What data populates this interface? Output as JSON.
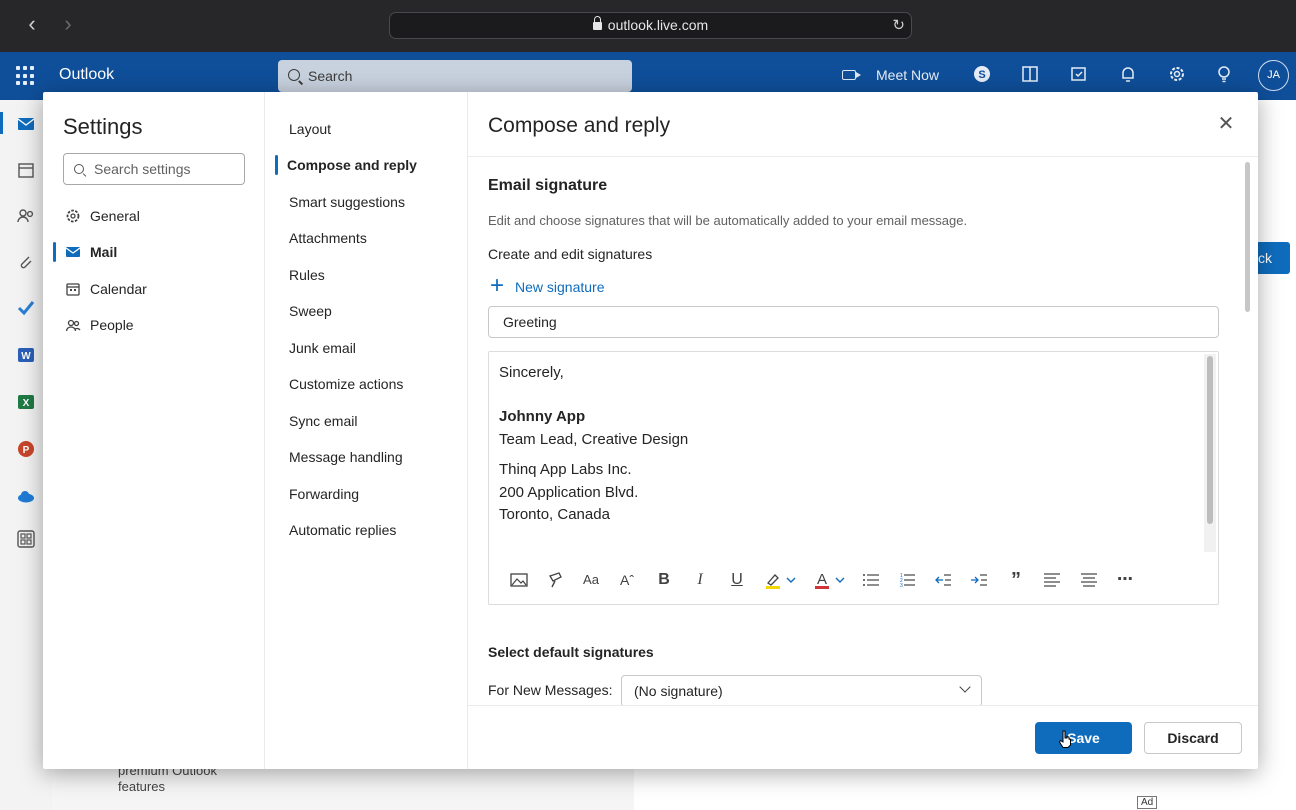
{
  "browser": {
    "url": "outlook.live.com"
  },
  "header": {
    "app_name": "Outlook",
    "search_placeholder": "Search",
    "meet_now": "Meet Now",
    "avatar_initials": "JA"
  },
  "background": {
    "premium_text_line1": "premium Outlook",
    "premium_text_line2": "features",
    "ad_badge": "Ad",
    "partial_button": "ck"
  },
  "settings": {
    "title": "Settings",
    "search_placeholder": "Search settings",
    "nav": [
      {
        "label": "General",
        "icon": "gear-icon"
      },
      {
        "label": "Mail",
        "icon": "mail-icon"
      },
      {
        "label": "Calendar",
        "icon": "calendar-icon"
      },
      {
        "label": "People",
        "icon": "people-icon"
      }
    ],
    "active_nav": "Mail",
    "subnav": [
      "Layout",
      "Compose and reply",
      "Smart suggestions",
      "Attachments",
      "Rules",
      "Sweep",
      "Junk email",
      "Customize actions",
      "Sync email",
      "Message handling",
      "Forwarding",
      "Automatic replies"
    ],
    "active_subnav": "Compose and reply"
  },
  "main": {
    "title": "Compose and reply",
    "section_title": "Email signature",
    "section_desc": "Edit and choose signatures that will be automatically added to your email message.",
    "create_label": "Create and edit signatures",
    "new_signature": "New signature",
    "signature_name": "Greeting",
    "signature_body": [
      "Sincerely,",
      "Johnny App",
      "Team Lead, Creative Design",
      "Thinq App Labs Inc.",
      "200 Application Blvd.",
      "Toronto, Canada"
    ],
    "default_title": "Select default signatures",
    "for_new_label": "For New Messages:",
    "for_new_value": "(No signature)",
    "save": "Save",
    "discard": "Discard"
  },
  "colors": {
    "accent": "#0f6cbd",
    "header": "#0f4f9a"
  }
}
